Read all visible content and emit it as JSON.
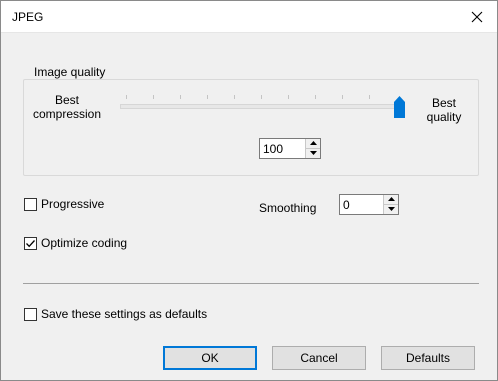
{
  "window": {
    "title": "JPEG"
  },
  "image_quality": {
    "group_label": "Image quality",
    "left_label_line1": "Best",
    "left_label_line2": "compression",
    "right_label_line1": "Best",
    "right_label_line2": "quality",
    "slider_value": 100,
    "value_field": "100"
  },
  "progressive": {
    "label": "Progressive",
    "checked": false
  },
  "smoothing": {
    "label": "Smoothing",
    "value": "0"
  },
  "optimize": {
    "label": "Optimize coding",
    "checked": true
  },
  "save_defaults": {
    "label": "Save these settings as defaults",
    "checked": false
  },
  "buttons": {
    "ok": "OK",
    "cancel": "Cancel",
    "defaults": "Defaults"
  },
  "colors": {
    "accent": "#0078d7",
    "dialog_bg": "#f0f0f0"
  },
  "icons": {
    "close": "close-icon",
    "spin_up": "arrow-up-icon",
    "spin_down": "arrow-down-icon",
    "check": "checkmark-icon",
    "slider_thumb": "slider-thumb-icon"
  }
}
